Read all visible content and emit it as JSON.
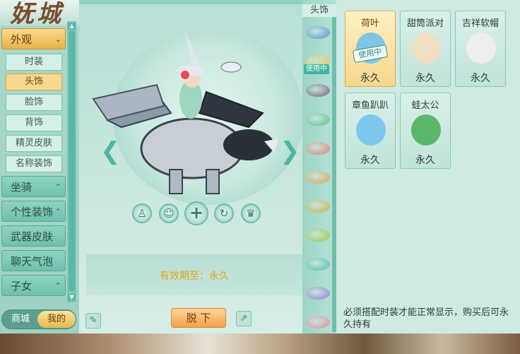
{
  "logo_text": "妩城",
  "sidebar": {
    "categories": [
      {
        "label": "外观",
        "chevron": "⌄"
      },
      {
        "label": "坐骑",
        "chevron": "⌃"
      },
      {
        "label": "个性装饰",
        "chevron": "⌃"
      },
      {
        "label": "武器皮肤",
        "chevron": ""
      },
      {
        "label": "聊天气泡",
        "chevron": ""
      },
      {
        "label": "子女",
        "chevron": "⌃"
      }
    ],
    "subs": [
      "时装",
      "头饰",
      "脸饰",
      "背饰",
      "精灵皮肤",
      "名称装饰"
    ],
    "active_sub_index": 1,
    "toggle": {
      "shop": "商城",
      "mine": "我的"
    }
  },
  "center": {
    "valid_until": "有效期至：永久",
    "take_off": "脱 下",
    "action_icons": [
      "person-icon",
      "costume-icon",
      "add-icon",
      "rotate-icon",
      "outfit-icon"
    ]
  },
  "strip": {
    "header": "头饰",
    "in_use": "使用中",
    "item_colors": [
      "#5a8fd8",
      "#e6c14a",
      "#7a5a7a",
      "#5fc08a",
      "#e08070",
      "#e0a050",
      "#c8b040",
      "#a0c040",
      "#50c0a8",
      "#9a78d8",
      "#e088a0"
    ]
  },
  "items": [
    {
      "name": "荷叶",
      "duration": "永久",
      "selected": true,
      "badge": "使用中",
      "color": "#7fc6e6"
    },
    {
      "name": "甜筒派对",
      "duration": "永久",
      "selected": false,
      "badge": "",
      "color": "#f0e0c0"
    },
    {
      "name": "吉祥软帽",
      "duration": "永久",
      "selected": false,
      "badge": "",
      "color": "#eeeeee"
    },
    {
      "name": "章鱼趴趴",
      "duration": "永久",
      "selected": false,
      "badge": "",
      "color": "#7cc8ee"
    },
    {
      "name": "蛙太公",
      "duration": "永久",
      "selected": false,
      "badge": "",
      "color": "#59b86a"
    }
  ],
  "notice": "必须搭配时装才能正常显示，购买后可永久持有"
}
